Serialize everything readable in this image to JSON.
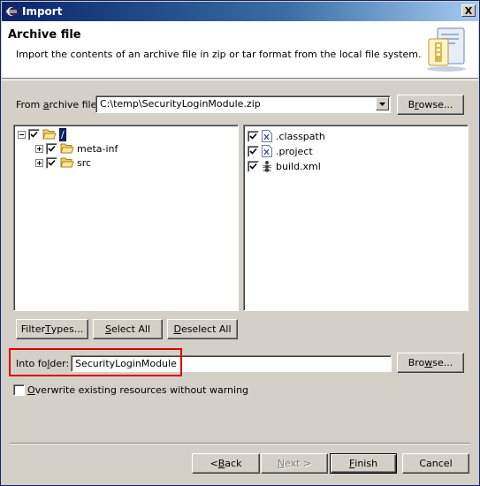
{
  "window": {
    "title": "Import",
    "close_label": "X"
  },
  "banner": {
    "title": "Archive file",
    "description": "Import the contents of an archive file in zip or tar format from the local file system."
  },
  "archive": {
    "label_pre": "From ",
    "label_mnemonic": "a",
    "label_post": "rchive file:",
    "value": "C:\\temp\\SecurityLoginModule.zip",
    "browse_pre": "B",
    "browse_mnemonic": "r",
    "browse_post": "owse..."
  },
  "tree": {
    "root_label": "/",
    "items": [
      {
        "label": "meta-inf"
      },
      {
        "label": "src"
      }
    ]
  },
  "files": {
    "items": [
      {
        "label": ".classpath"
      },
      {
        "label": ".project"
      },
      {
        "label": "build.xml"
      }
    ]
  },
  "selection_buttons": {
    "filter_pre": "Filter ",
    "filter_mnemonic": "T",
    "filter_post": "ypes...",
    "select_all_pre": "",
    "select_all_mnemonic": "S",
    "select_all_post": "elect All",
    "deselect_all_pre": "",
    "deselect_all_mnemonic": "D",
    "deselect_all_post": "eselect All"
  },
  "into_folder": {
    "label_pre": "Into fo",
    "label_mnemonic": "l",
    "label_post": "der:",
    "value": "SecurityLoginModule",
    "browse_pre": "Bro",
    "browse_mnemonic": "w",
    "browse_post": "se..."
  },
  "overwrite": {
    "label_mnemonic": "O",
    "label_post": "verwrite existing resources without warning",
    "checked": false
  },
  "footer": {
    "back_pre": "< ",
    "back_mnemonic": "B",
    "back_post": "ack",
    "next_pre": "",
    "next_mnemonic": "N",
    "next_post": "ext >",
    "finish_pre": "",
    "finish_mnemonic": "F",
    "finish_post": "inish",
    "cancel_label": "Cancel"
  },
  "colors": {
    "titlebar_start": "#0a246a",
    "titlebar_end": "#a6caf0",
    "dialog_bg": "#d4d0c8",
    "highlight_box": "#e00000"
  }
}
